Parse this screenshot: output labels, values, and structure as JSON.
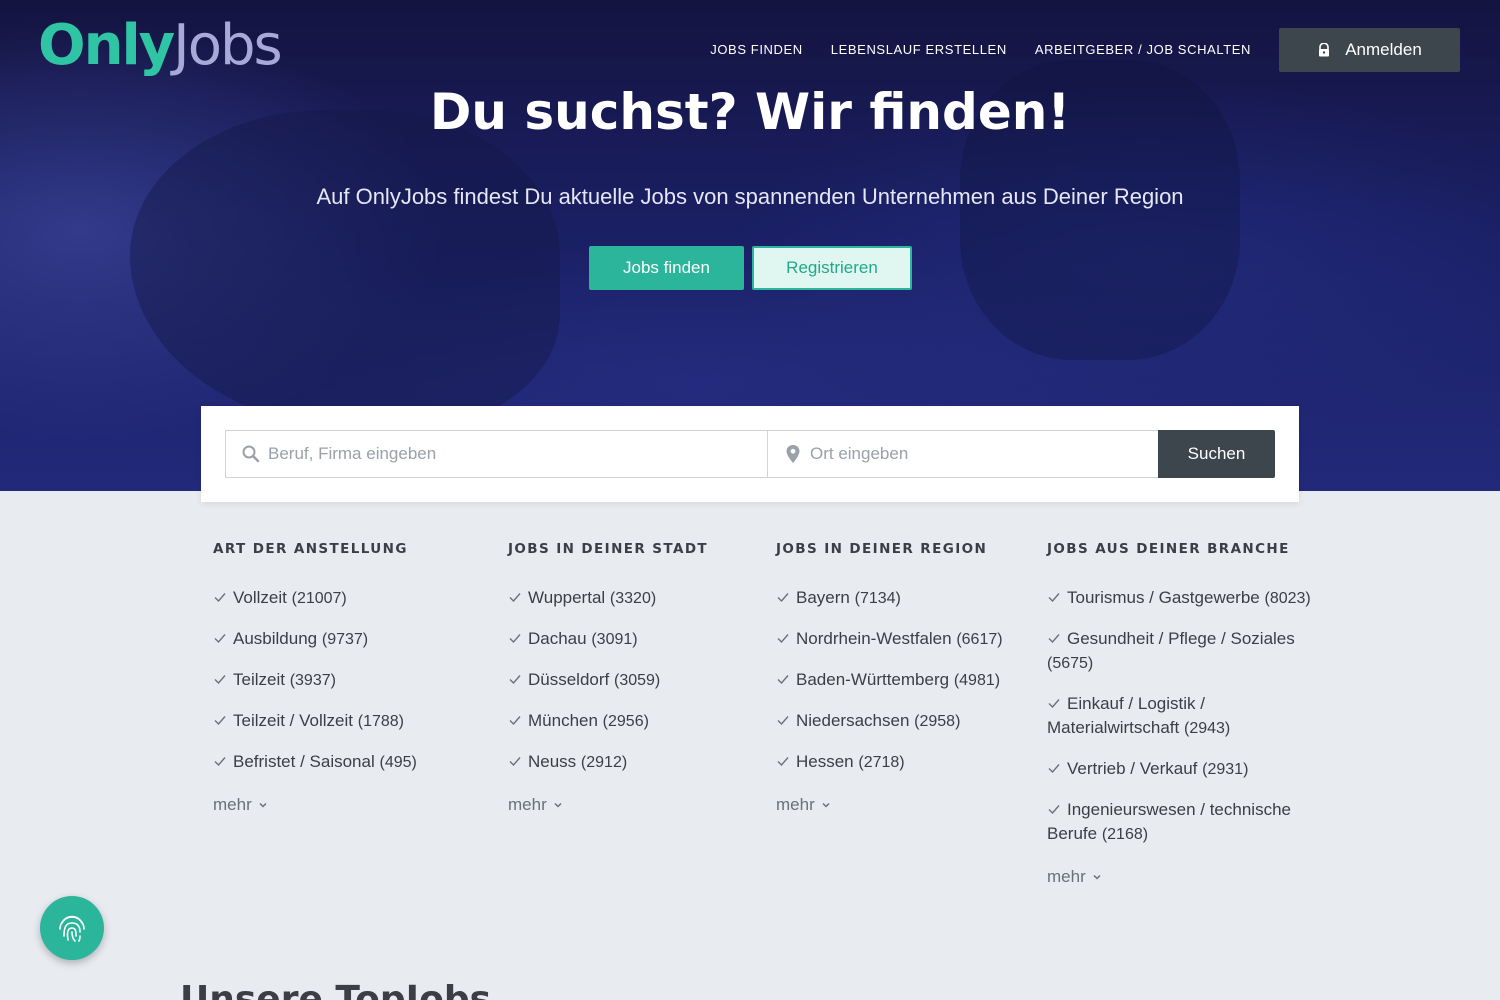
{
  "brand": {
    "name_part1": "Only",
    "name_part2": "Jobs"
  },
  "nav": {
    "items": [
      "JOBS FINDEN",
      "LEBENSLAUF ERSTELLEN",
      "ARBEITGEBER / JOB SCHALTEN"
    ],
    "login_label": "Anmelden"
  },
  "hero": {
    "headline": "Du suchst? Wir finden!",
    "subline": "Auf OnlyJobs findest Du aktuelle Jobs von spannenden Unternehmen aus Deiner Region",
    "primary_button": "Jobs finden",
    "secondary_button": "Registrieren"
  },
  "search": {
    "what_placeholder": "Beruf, Firma eingeben",
    "where_placeholder": "Ort eingeben",
    "button_label": "Suchen"
  },
  "columns": [
    {
      "title": "ART DER ANSTELLUNG",
      "items": [
        {
          "label": "Vollzeit",
          "count": "(21007)"
        },
        {
          "label": "Ausbildung",
          "count": "(9737)"
        },
        {
          "label": "Teilzeit",
          "count": "(3937)"
        },
        {
          "label": "Teilzeit / Vollzeit",
          "count": "(1788)"
        },
        {
          "label": "Befristet / Saisonal",
          "count": "(495)"
        }
      ],
      "more": "mehr"
    },
    {
      "title": "JOBS IN DEINER STADT",
      "items": [
        {
          "label": "Wuppertal",
          "count": "(3320)"
        },
        {
          "label": "Dachau",
          "count": "(3091)"
        },
        {
          "label": "Düsseldorf",
          "count": "(3059)"
        },
        {
          "label": "München",
          "count": "(2956)"
        },
        {
          "label": "Neuss",
          "count": "(2912)"
        }
      ],
      "more": "mehr"
    },
    {
      "title": "JOBS IN DEINER REGION",
      "items": [
        {
          "label": "Bayern",
          "count": "(7134)"
        },
        {
          "label": "Nordrhein-Westfalen",
          "count": "(6617)"
        },
        {
          "label": "Baden-Württemberg",
          "count": "(4981)"
        },
        {
          "label": "Niedersachsen",
          "count": "(2958)"
        },
        {
          "label": "Hessen",
          "count": "(2718)"
        }
      ],
      "more": "mehr"
    },
    {
      "title": "JOBS AUS DEINER BRANCHE",
      "items": [
        {
          "label": "Tourismus / Gastgewerbe",
          "count": "(8023)"
        },
        {
          "label": "Gesundheit / Pflege / Soziales",
          "count": "(5675)"
        },
        {
          "label": "Einkauf / Logistik / Materialwirtschaft",
          "count": "(2943)"
        },
        {
          "label": "Vertrieb / Verkauf",
          "count": "(2931)"
        },
        {
          "label": "Ingenieurswesen / technische Berufe",
          "count": "(2168)"
        }
      ],
      "more": "mehr"
    }
  ],
  "section": {
    "title": "Unsere TopJobs"
  },
  "colors": {
    "accent": "#2bb59a",
    "dark_button": "#3d454d",
    "hero_bg": "#1a1f63"
  },
  "icons": [
    "lock-icon",
    "search-icon",
    "location-pin-icon",
    "check-icon",
    "chevron-down-icon",
    "fingerprint-icon"
  ]
}
